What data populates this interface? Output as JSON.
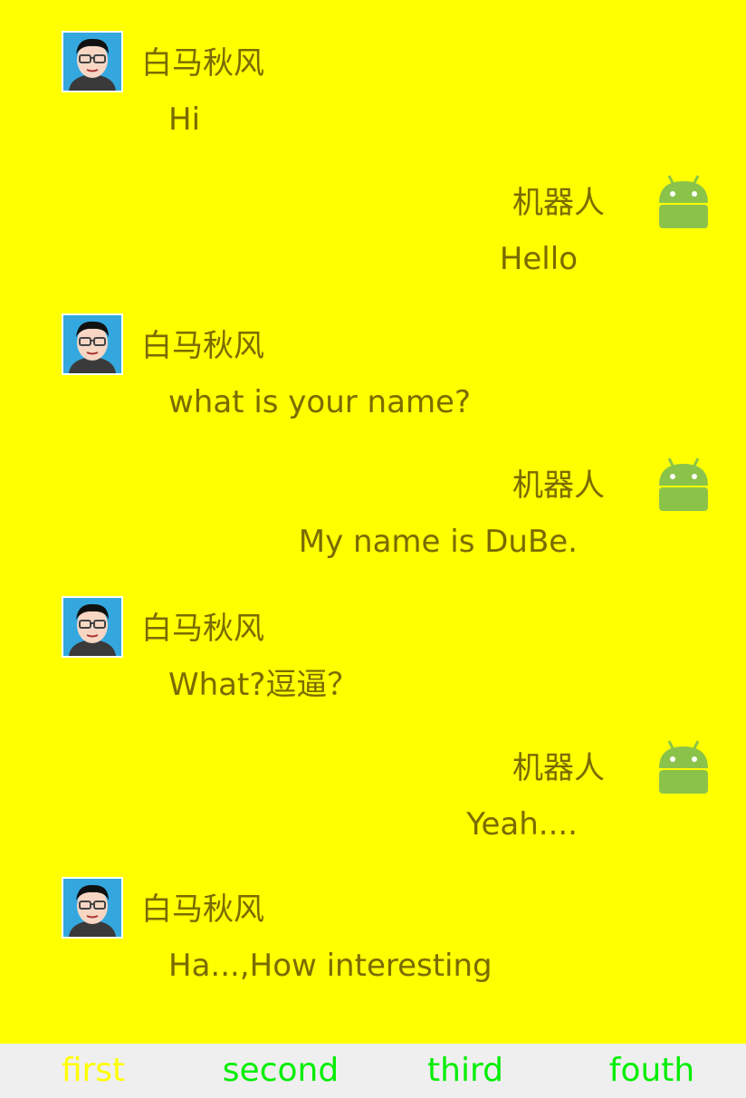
{
  "theme": {
    "background": "#ffff00",
    "text_color": "#7a6b00",
    "tab_active_color": "#ffff00",
    "tab_inactive_color": "#00ee00",
    "bar_background": "#efefef"
  },
  "messages": [
    {
      "side": "left",
      "sender": "白马秋风",
      "avatar_icon": "user-avatar-icon",
      "text": "Hi"
    },
    {
      "side": "right",
      "sender": "机器人",
      "avatar_icon": "android-robot-icon",
      "text": "Hello"
    },
    {
      "side": "left",
      "sender": "白马秋风",
      "avatar_icon": "user-avatar-icon",
      "text": "what is your name?"
    },
    {
      "side": "right",
      "sender": "机器人",
      "avatar_icon": "android-robot-icon",
      "text": "My name is DuBe."
    },
    {
      "side": "left",
      "sender": "白马秋风",
      "avatar_icon": "user-avatar-icon",
      "text": "What?逗逼？"
    },
    {
      "side": "right",
      "sender": "机器人",
      "avatar_icon": "android-robot-icon",
      "text": "Yeah...."
    },
    {
      "side": "left",
      "sender": "白马秋风",
      "avatar_icon": "user-avatar-icon",
      "text": "Ha...,How interesting"
    }
  ],
  "tabs": [
    {
      "label": "first",
      "active": true
    },
    {
      "label": "second",
      "active": false
    },
    {
      "label": "third",
      "active": false
    },
    {
      "label": "fouth",
      "active": false
    }
  ]
}
